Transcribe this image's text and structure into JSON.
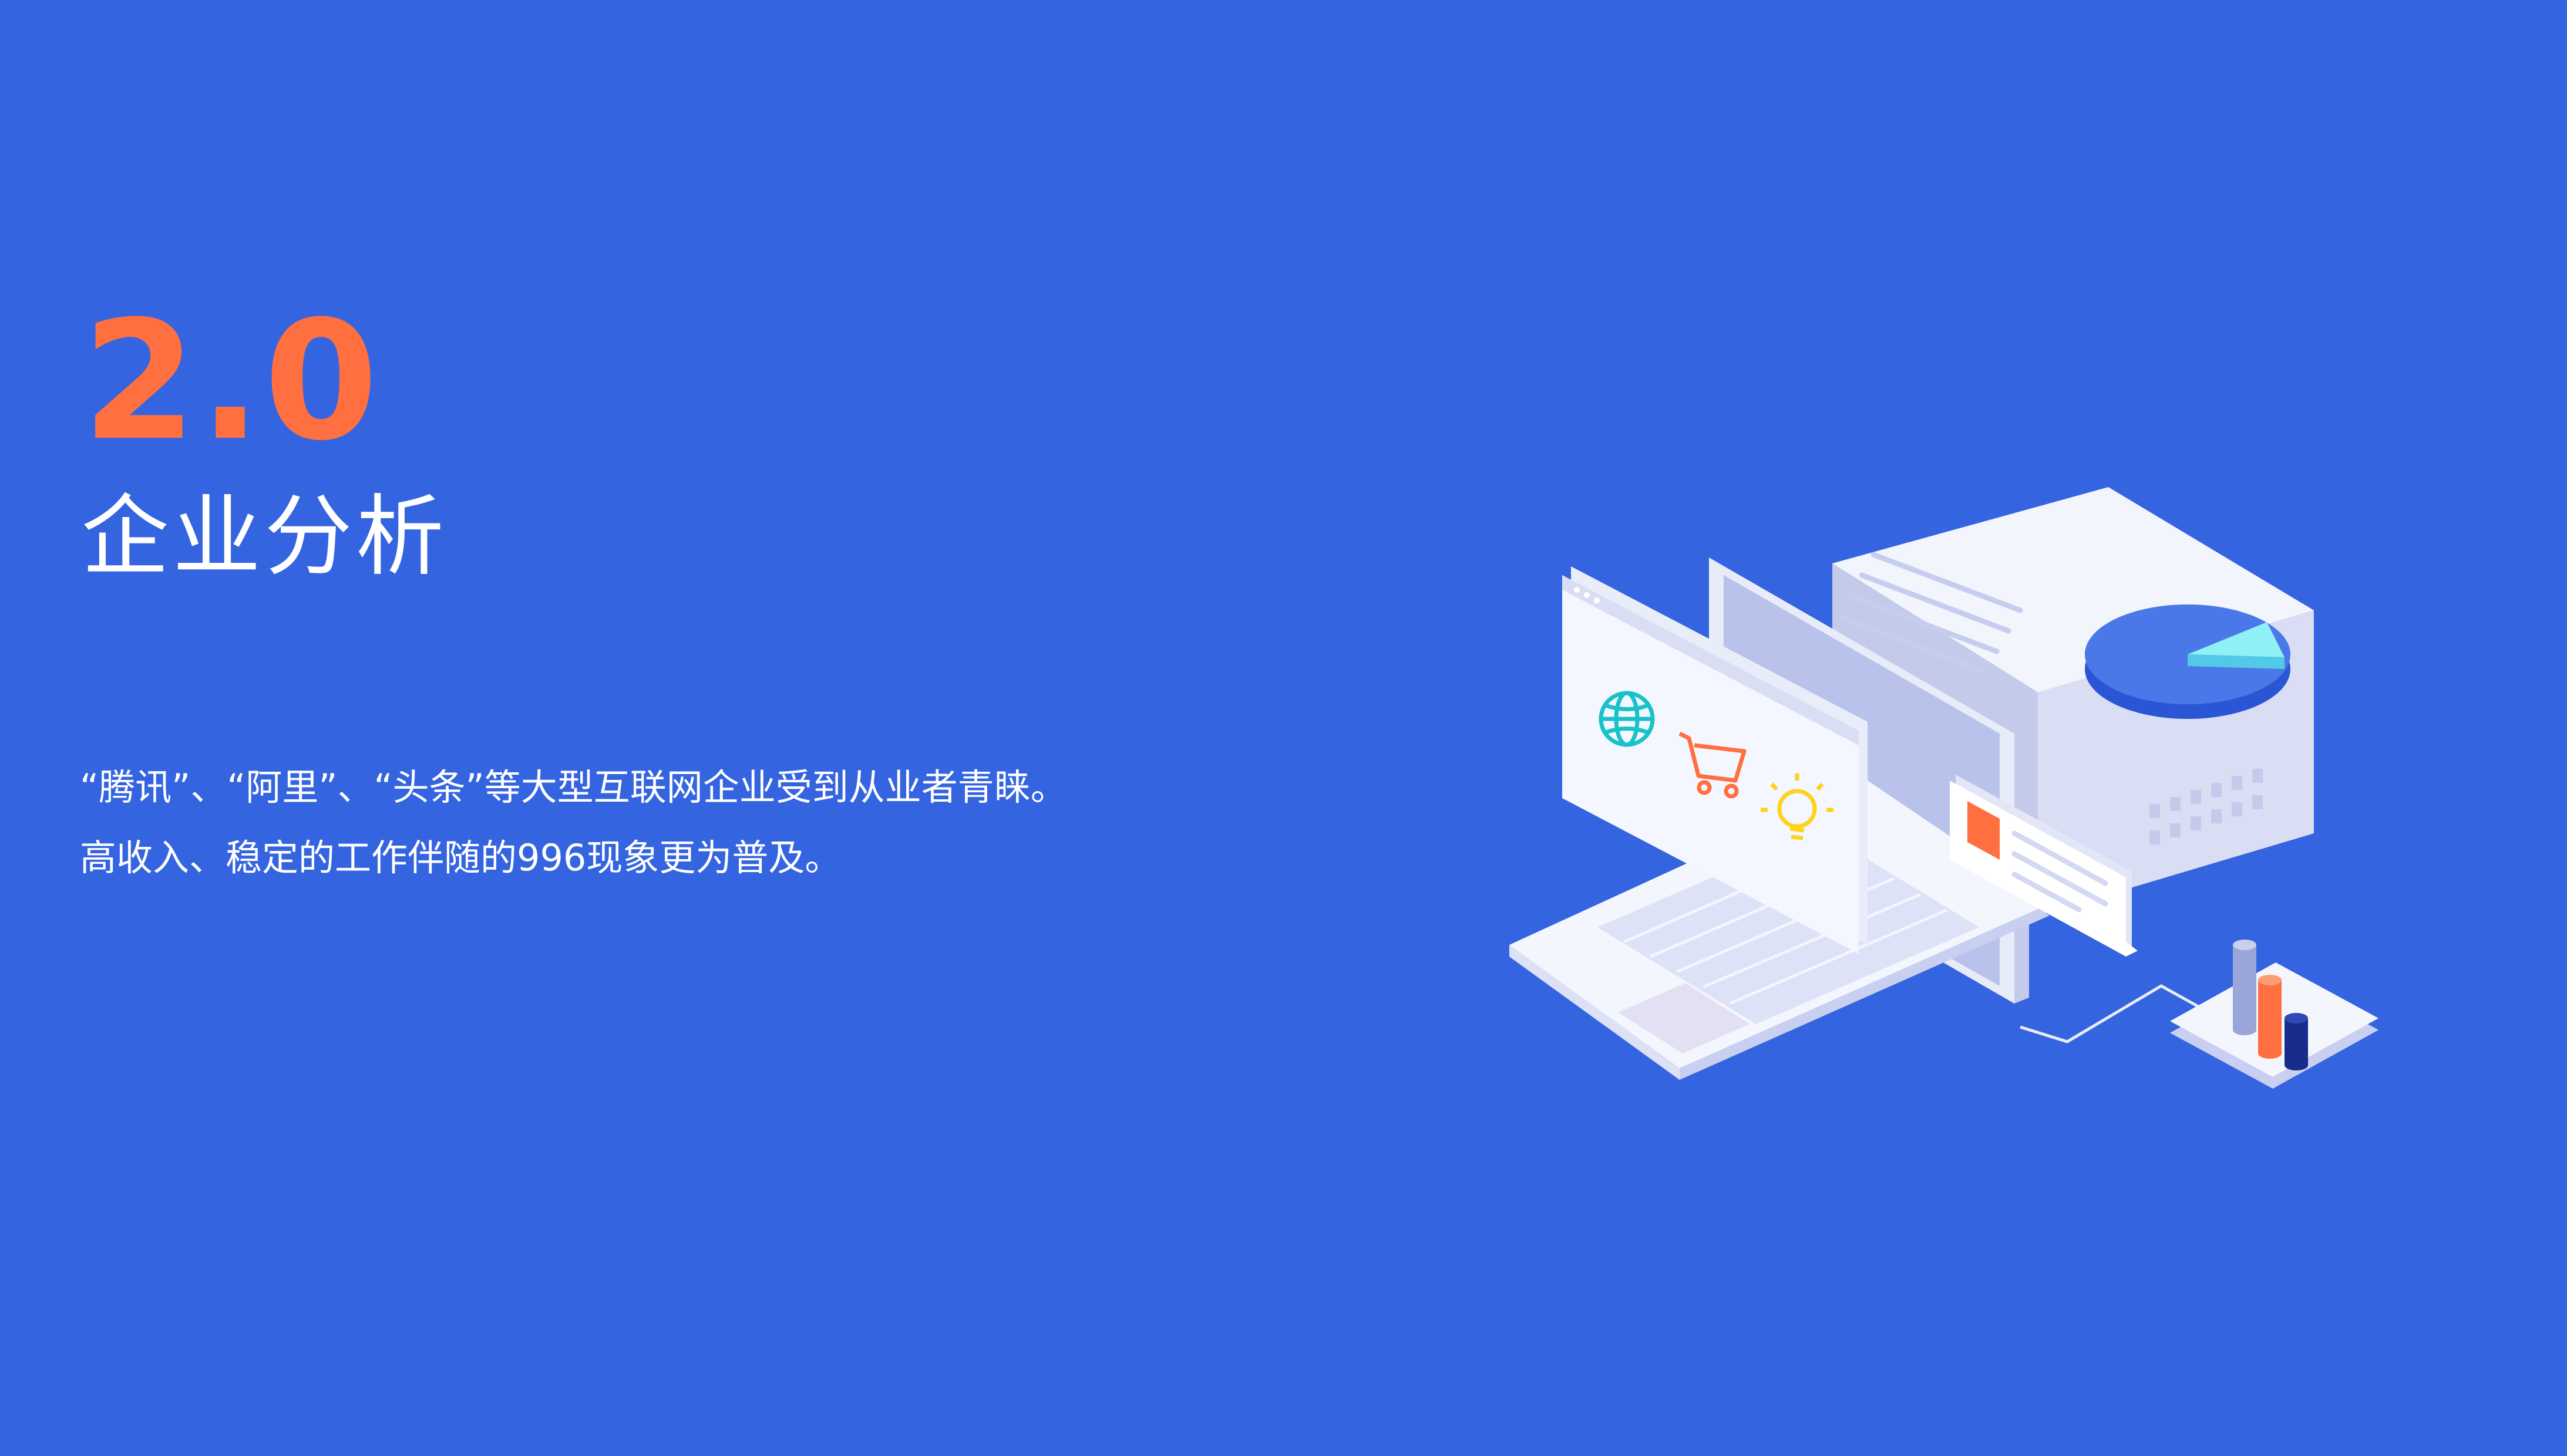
{
  "section": {
    "number": "2.0",
    "title": "企业分析"
  },
  "body": {
    "lines": [
      "“腾讯”、“阿里”、“头条”等大型互联网企业受到从业者青睐。",
      "高收入、稳定的工作伴随的996现象更为普及。"
    ]
  },
  "colors": {
    "background": "#3464e0",
    "accent": "#ff6f3f",
    "text": "#ffffff"
  },
  "illustration": {
    "icons": [
      "globe-icon",
      "shopping-cart-icon",
      "lightbulb-icon",
      "pie-chart-icon",
      "bar-chart-icon"
    ]
  }
}
